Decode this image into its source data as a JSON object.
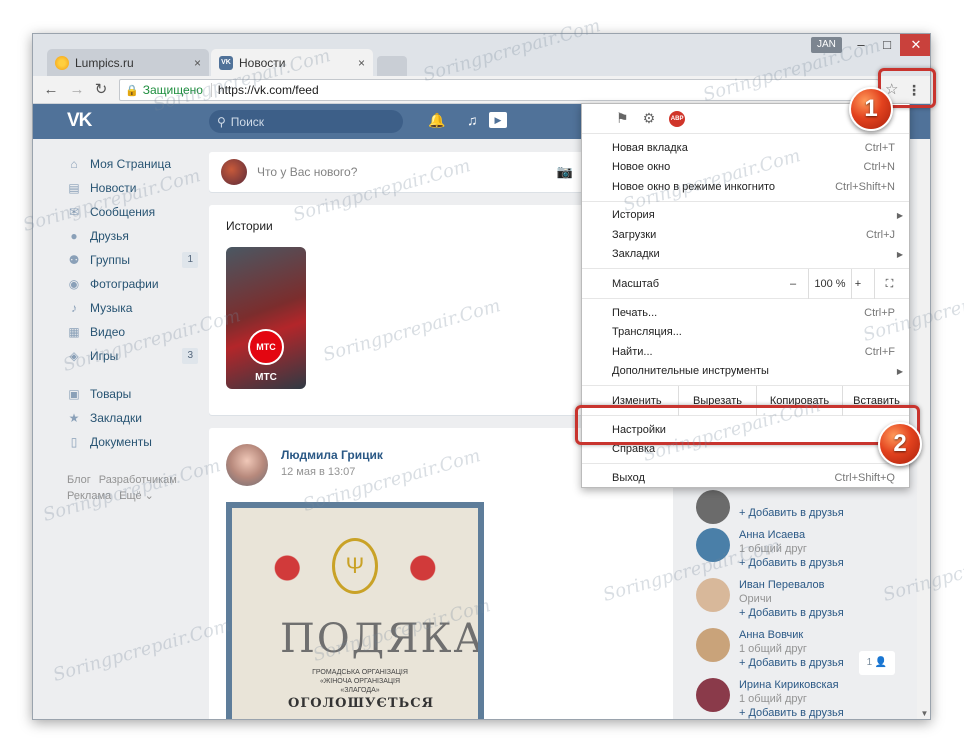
{
  "browser": {
    "tabs": [
      {
        "title": "Lumpics.ru",
        "close": "×"
      },
      {
        "title": "Новости",
        "close": "×"
      }
    ],
    "user_badge": "JAN",
    "window_controls": {
      "minimize": "–",
      "maximize": "□",
      "close": "✕"
    },
    "nav": {
      "back": "←",
      "forward": "→",
      "reload": "↻"
    },
    "address": {
      "secure_label": "Защищено",
      "url": "https://vk.com/feed"
    },
    "star": "☆",
    "menu_glyph": "⋮"
  },
  "vk": {
    "logo": "VK",
    "search_placeholder": "Поиск",
    "sidebar": [
      {
        "label": "Моя Страница",
        "icon": "home-icon",
        "glyph": "⌂"
      },
      {
        "label": "Новости",
        "icon": "news-icon",
        "glyph": "▤"
      },
      {
        "label": "Сообщения",
        "icon": "messages-icon",
        "glyph": "✉"
      },
      {
        "label": "Друзья",
        "icon": "friends-icon",
        "glyph": "●"
      },
      {
        "label": "Группы",
        "icon": "groups-icon",
        "glyph": "⚉",
        "count": "1"
      },
      {
        "label": "Фотографии",
        "icon": "photos-icon",
        "glyph": "◉"
      },
      {
        "label": "Музыка",
        "icon": "music-icon",
        "glyph": "♪"
      },
      {
        "label": "Видео",
        "icon": "video-icon",
        "glyph": "▦"
      },
      {
        "label": "Игры",
        "icon": "games-icon",
        "glyph": "◈",
        "count": "3"
      }
    ],
    "sidebar2": [
      {
        "label": "Товары",
        "icon": "goods-icon",
        "glyph": "▣"
      },
      {
        "label": "Закладки",
        "icon": "bookmarks-icon",
        "glyph": "★"
      },
      {
        "label": "Документы",
        "icon": "documents-icon",
        "glyph": "▯"
      }
    ],
    "footer": {
      "blog": "Блог",
      "dev": "Разработчикам",
      "ads": "Реклама",
      "more": "Ещё ⌄"
    },
    "composer_placeholder": "Что у Вас нового?",
    "stories": {
      "title": "Истории",
      "badge": "МТС",
      "label": "МТС"
    },
    "post": {
      "author": "Людмила Грицик",
      "date": "12 мая в 13:07",
      "image_title": "ПОДЯКА",
      "image_line1": "ГРОМАДСЬКА ОРГАНІЗАЦІЯ «ЖІНОЧА ОРГАНІЗАЦІЯ «ЗЛАГОДА»",
      "image_line2": "ОГОЛОШУЄТЬСЯ"
    },
    "friends": [
      {
        "name": "",
        "sub": "",
        "add": "+ Добавить в друзья",
        "color": "#6b6b6b"
      },
      {
        "name": "Анна Исаева",
        "sub": "1 общий друг",
        "add": "+ Добавить в друзья",
        "color": "#4a7fa8"
      },
      {
        "name": "Иван Перевалов",
        "sub": "Оричи",
        "add": "+ Добавить в друзья",
        "color": "#d8b89a"
      },
      {
        "name": "Анна Вовчик",
        "sub": "1 общий друг",
        "add": "+ Добавить в друзья",
        "color": "#c9a37a"
      },
      {
        "name": "Ирина Кириковская",
        "sub": "1 общий друг",
        "add": "+ Добавить в друзья",
        "color": "#8a3a4a"
      }
    ],
    "chat_count": "1 👤"
  },
  "menu": {
    "group1": [
      {
        "label": "Новая вкладка",
        "shortcut": "Ctrl+T"
      },
      {
        "label": "Новое окно",
        "shortcut": "Ctrl+N"
      },
      {
        "label": "Новое окно в режиме инкогнито",
        "shortcut": "Ctrl+Shift+N"
      }
    ],
    "group2": [
      {
        "label": "История",
        "shortcut": "",
        "arrow": "▶"
      },
      {
        "label": "Загрузки",
        "shortcut": "Ctrl+J",
        "arrow": ""
      },
      {
        "label": "Закладки",
        "shortcut": "",
        "arrow": "▶"
      }
    ],
    "zoom": {
      "label": "Масштаб",
      "minus": "–",
      "value": "100 %",
      "plus": "+",
      "fullscreen": "⛶"
    },
    "group3": [
      {
        "label": "Печать...",
        "shortcut": "Ctrl+P",
        "arrow": ""
      },
      {
        "label": "Трансляция...",
        "shortcut": "",
        "arrow": ""
      },
      {
        "label": "Найти...",
        "shortcut": "Ctrl+F",
        "arrow": ""
      },
      {
        "label": "Дополнительные инструменты",
        "shortcut": "",
        "arrow": "▶"
      }
    ],
    "edit": {
      "label": "Изменить",
      "cut": "Вырезать",
      "copy": "Копировать",
      "paste": "Вставить"
    },
    "group4": [
      {
        "label": "Настройки",
        "shortcut": ""
      },
      {
        "label": "Справка",
        "shortcut": ""
      }
    ],
    "exit": {
      "label": "Выход",
      "shortcut": "Ctrl+Shift+Q"
    },
    "abp_label": "ABP"
  },
  "annotations": {
    "marker1": "1",
    "marker2": "2"
  },
  "watermark": "Soringpcrepair.Com",
  "colors": {
    "vk_blue": "#507299",
    "highlight": "#c8342e",
    "close_red": "#c9413c"
  }
}
